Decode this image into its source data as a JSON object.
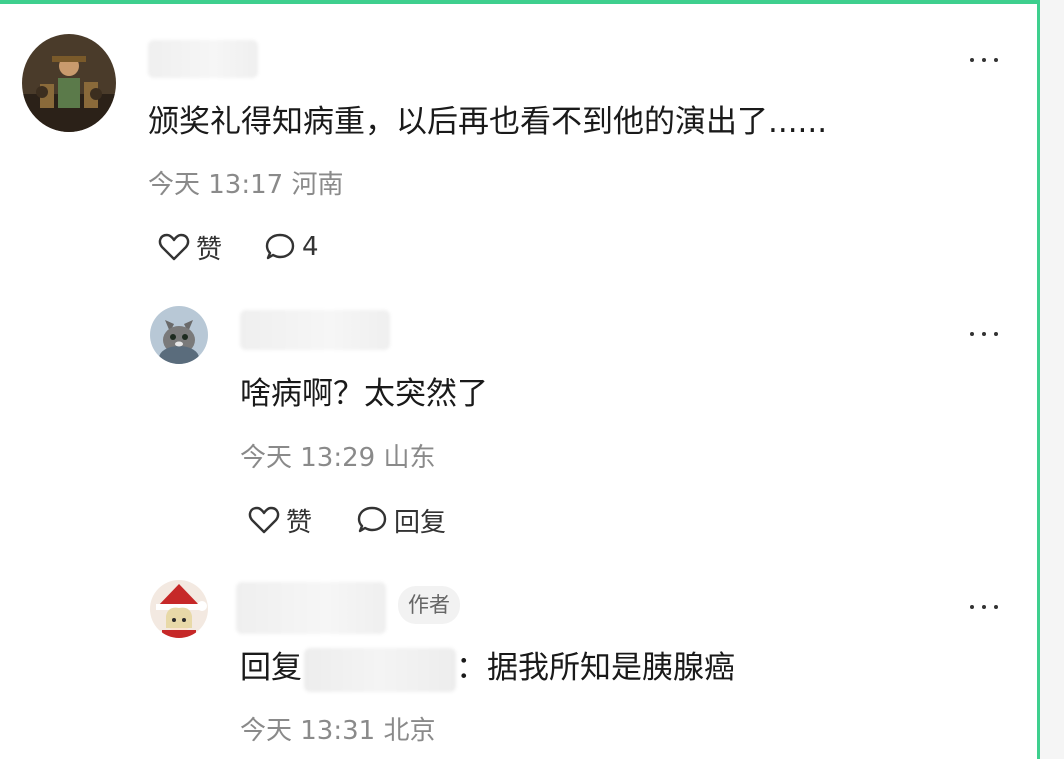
{
  "comments": [
    {
      "text": "颁奖礼得知病重，以后再也看不到他的演出了......",
      "meta": "今天 13:17 河南",
      "like_label": "赞",
      "reply_count": "4"
    },
    {
      "text": "啥病啊？太突然了",
      "meta": "今天 13:29 山东",
      "like_label": "赞",
      "reply_label": "回复"
    },
    {
      "author_badge": "作者",
      "reply_prefix": "回复",
      "reply_text": "：据我所知是胰腺癌",
      "meta": "今天 13:31 北京"
    }
  ],
  "icons": {
    "like": "heart-outline-icon",
    "comment": "speech-bubble-icon",
    "more": "more-dots-icon"
  },
  "colors": {
    "frame_border": "#3ecf8e",
    "meta_text": "#8a8a8a"
  }
}
